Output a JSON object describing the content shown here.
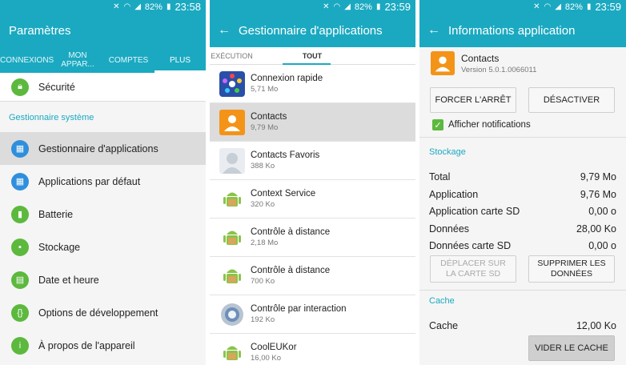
{
  "status_bars": [
    {
      "battery": "82%",
      "time": "23:58"
    },
    {
      "battery": "82%",
      "time": "23:59"
    },
    {
      "battery": "82%",
      "time": "23:59"
    }
  ],
  "colors": {
    "accent": "#1ba9c1",
    "selected_row": "#dcdcdc"
  },
  "settings": {
    "title": "Paramètres",
    "tabs": [
      "CONNEXIONS",
      "MON APPAR...",
      "COMPTES",
      "PLUS"
    ],
    "items_top": [
      {
        "label": "Sécurité",
        "icon": "lock-icon"
      }
    ],
    "section": "Gestionnaire système",
    "items": [
      {
        "label": "Gestionnaire d'applications",
        "icon": "apps-grid-icon",
        "color": "#2f8fdc"
      },
      {
        "label": "Applications par défaut",
        "icon": "default-apps-icon",
        "color": "#2f8fdc"
      },
      {
        "label": "Batterie",
        "icon": "battery-icon",
        "color": "#5cb93e"
      },
      {
        "label": "Stockage",
        "icon": "storage-icon",
        "color": "#5cb93e"
      },
      {
        "label": "Date et heure",
        "icon": "calendar-icon",
        "color": "#5cb93e"
      },
      {
        "label": "Options de développement",
        "icon": "braces-icon",
        "color": "#5cb93e"
      },
      {
        "label": "À propos de l'appareil",
        "icon": "info-icon",
        "color": "#5cb93e"
      }
    ]
  },
  "app_manager": {
    "title": "Gestionnaire d'applications",
    "tabs": [
      "EXÉCUTION",
      "TOUT"
    ],
    "apps": [
      {
        "name": "Connexion rapide",
        "size": "5,71 Mo",
        "icon": "quick-connect-icon"
      },
      {
        "name": "Contacts",
        "size": "9,79 Mo",
        "icon": "contacts-icon"
      },
      {
        "name": "Contacts Favoris",
        "size": "388 Ko",
        "icon": "person-avatar-icon"
      },
      {
        "name": "Context Service",
        "size": "320 Ko",
        "icon": "android-icon"
      },
      {
        "name": "Contrôle à distance",
        "size": "2,18 Mo",
        "icon": "android-icon"
      },
      {
        "name": "Contrôle à distance",
        "size": "700 Ko",
        "icon": "android-icon"
      },
      {
        "name": "Contrôle par interaction",
        "size": "192 Ko",
        "icon": "interaction-icon"
      },
      {
        "name": "CoolEUKor",
        "size": "16,00 Ko",
        "icon": "android-icon"
      }
    ]
  },
  "app_info": {
    "title": "Informations application",
    "app_name": "Contacts",
    "version": "Version 5.0.1.0066011",
    "force_stop": "FORCER L'ARRÊT",
    "disable": "DÉSACTIVER",
    "show_notifications": "Afficher notifications",
    "storage_section": "Stockage",
    "storage": [
      {
        "label": "Total",
        "value": "9,79 Mo"
      },
      {
        "label": "Application",
        "value": "9,76 Mo"
      },
      {
        "label": "Application carte SD",
        "value": "0,00 o"
      },
      {
        "label": "Données",
        "value": "28,00 Ko"
      },
      {
        "label": "Données carte SD",
        "value": "0,00 o"
      }
    ],
    "move_sd": "DÉPLACER SUR LA CARTE SD",
    "clear_data": "SUPPRIMER LES DONNÉES",
    "cache_section": "Cache",
    "cache_label": "Cache",
    "cache_value": "12,00 Ko",
    "clear_cache": "VIDER LE CACHE"
  }
}
